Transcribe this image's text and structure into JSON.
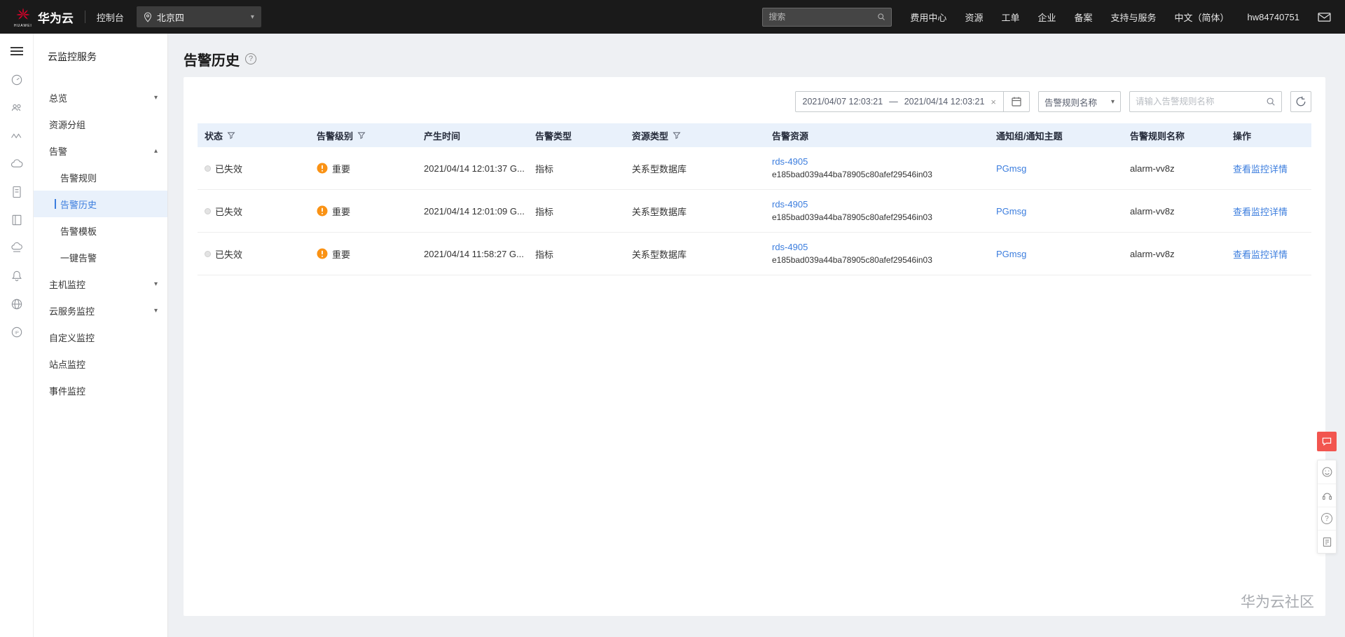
{
  "colors": {
    "accent_blue": "#3b7dde",
    "severity_orange": "#fa9214",
    "feedback_red": "#f2554f",
    "topbar_bg": "#1a1a1a",
    "table_header_bg": "#e9f1fb"
  },
  "icons": {
    "caret_down": "▾",
    "caret_up": "▴",
    "close": "×",
    "question": "?"
  },
  "topbar": {
    "logo_text": "HUAWEI",
    "brand": "华为云",
    "console": "控制台",
    "region": "北京四",
    "search_placeholder": "搜索",
    "menu": [
      "费用中心",
      "资源",
      "工单",
      "企业",
      "备案",
      "支持与服务",
      "中文（简体）",
      "hw84740751"
    ]
  },
  "sidebar": {
    "title": "云监控服务",
    "items": [
      "总览",
      "资源分组",
      "告警",
      "告警规则",
      "告警历史",
      "告警模板",
      "一键告警",
      "主机监控",
      "云服务监控",
      "自定义监控",
      "站点监控",
      "事件监控"
    ]
  },
  "page": {
    "title": "告警历史"
  },
  "filters": {
    "date_start": "2021/04/07 12:03:21",
    "date_separator": "—",
    "date_end": "2021/04/14 12:03:21",
    "rule_select": "告警规则名称",
    "search_placeholder": "请输入告警规则名称"
  },
  "table": {
    "headers": [
      "状态",
      "告警级别",
      "产生时间",
      "告警类型",
      "资源类型",
      "告警资源",
      "通知组/通知主题",
      "告警规则名称",
      "操作"
    ],
    "rows": [
      {
        "status": "已失效",
        "severity": "重要",
        "time": "2021/04/14 12:01:37 G...",
        "alarm_type": "指标",
        "resource_type": "关系型数据库",
        "resource_name": "rds-4905",
        "resource_id": "e185bad039a44ba78905c80afef29546in03",
        "notification": "PGmsg",
        "rule_name": "alarm-vv8z",
        "action": "查看监控详情"
      },
      {
        "status": "已失效",
        "severity": "重要",
        "time": "2021/04/14 12:01:09 G...",
        "alarm_type": "指标",
        "resource_type": "关系型数据库",
        "resource_name": "rds-4905",
        "resource_id": "e185bad039a44ba78905c80afef29546in03",
        "notification": "PGmsg",
        "rule_name": "alarm-vv8z",
        "action": "查看监控详情"
      },
      {
        "status": "已失效",
        "severity": "重要",
        "time": "2021/04/14 11:58:27 G...",
        "alarm_type": "指标",
        "resource_type": "关系型数据库",
        "resource_name": "rds-4905",
        "resource_id": "e185bad039a44ba78905c80afef29546in03",
        "notification": "PGmsg",
        "rule_name": "alarm-vv8z",
        "action": "查看监控详情"
      }
    ]
  },
  "footer": {
    "watermark": "华为云社区"
  }
}
